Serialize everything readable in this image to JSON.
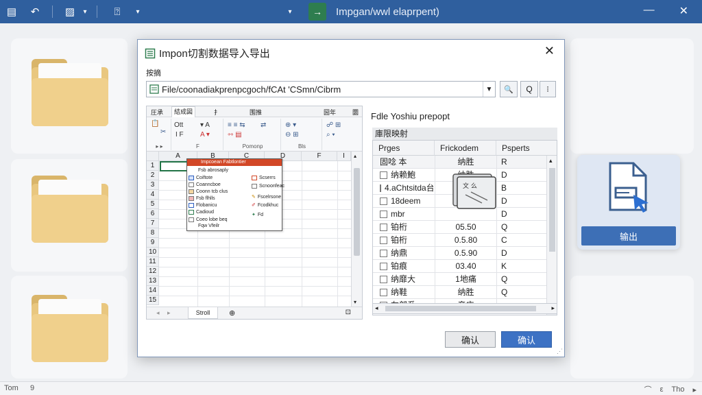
{
  "app": {
    "title": "Impgan/wwl elaprpent)",
    "title_arrow": "→"
  },
  "export_card": {
    "button_label": "输出"
  },
  "statusbar": {
    "left": "Tom",
    "left2": "9",
    "right_items": [
      "⌒",
      "ε",
      "Tho",
      "▸"
    ]
  },
  "dialog": {
    "title": "Impon切割数据导入导出",
    "label": "按摘",
    "path": "File/coonadiakprenpcgoch/fCAt 'CSmn/Cibrm",
    "tool_buttons": [
      "🔍",
      "Q",
      "⁝"
    ],
    "ok_label": "确认",
    "confirm_label": "确认"
  },
  "sheet": {
    "ribbon_tabs": [
      "圧承",
      "結成図",
      "扌",
      "围推",
      "圀年",
      "圜"
    ],
    "ribbon_groups": [
      "F",
      "Fi",
      "Pomonp",
      "Bls",
      ""
    ],
    "columns": [
      "A",
      "B",
      "C",
      "D",
      "F",
      "I"
    ],
    "rows": [
      "1",
      "2",
      "3",
      "4",
      "5",
      "6",
      "7",
      "8",
      "9",
      "10",
      "11",
      "12",
      "13",
      "14",
      "15",
      "16"
    ],
    "tab_name": "Stroll",
    "ctx_header": "Impcoean Fabtlontier",
    "ctx_items_left": [
      "Fsb abrosaply",
      "Coiftote",
      "Coanncboe",
      "Coonn tcb clus",
      "Fsb flhlls",
      "Flobanicu",
      "Cadioud",
      "Coeo lobe beq",
      "Fqw Vfeilr"
    ],
    "ctx_items_right": [
      "Scserrs",
      "Scnoonfeac",
      "Fscelrsone",
      "Fcodkhuc",
      "Fd"
    ]
  },
  "panel": {
    "title": "Fdle Yoshiu prepopt",
    "subtitle": "庫限映射",
    "headers": [
      "Prges",
      "Frickodem",
      "Psperts"
    ],
    "rows": [
      {
        "name": "固唸 本",
        "val": "纳胜",
        "prop": "R",
        "checkbox": false
      },
      {
        "name": "纳赖鮑",
        "val": "纳胜",
        "prop": "D",
        "checkbox": true
      },
      {
        "name": "4.aChtsitda台",
        "val": "纳胜",
        "prop": "B",
        "checkbox": true
      },
      {
        "name": "18deem",
        "val": "",
        "prop": "D",
        "checkbox": true
      },
      {
        "name": "mbr",
        "val": "",
        "prop": "D",
        "checkbox": true
      },
      {
        "name": "铂桁",
        "val": "05.50",
        "prop": "Q",
        "checkbox": true
      },
      {
        "name": "铂桁",
        "val": "0.5.80",
        "prop": "C",
        "checkbox": true
      },
      {
        "name": "纳鼎",
        "val": "0.5.90",
        "prop": "D",
        "checkbox": true
      },
      {
        "name": "铂痕",
        "val": "03.40",
        "prop": "K",
        "checkbox": true
      },
      {
        "name": "纳靡大",
        "val": "1地痛",
        "prop": "Q",
        "checkbox": true
      },
      {
        "name": "纳鞋",
        "val": "纳胜",
        "prop": "Q",
        "checkbox": true
      },
      {
        "name": "左部系",
        "val": "产庄",
        "prop": "",
        "checkbox": true
      }
    ]
  },
  "colors": {
    "titlebar": "#2f5f9e",
    "accent": "#3d72c4",
    "excel_green": "#217346",
    "ctx_red": "#d24726"
  }
}
